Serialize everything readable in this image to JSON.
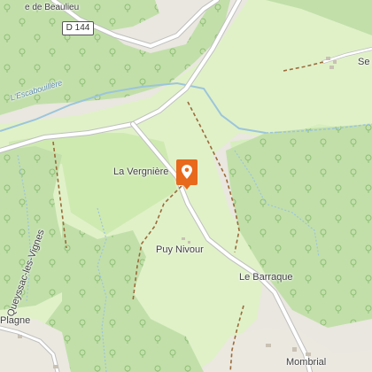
{
  "map": {
    "road_shield": "D 144",
    "labels": {
      "beaulieu": "e de Beaulieu",
      "escabouillere": "L'Escabouillère",
      "vergniere": "La Vergnière",
      "puy_nivour": "Puy Nivour",
      "barraque": "Le Barraque",
      "queyssac": "Queyssac-les-Vignes",
      "plagne": "Plagne",
      "mombrial": "Mombrial",
      "se": "Se"
    },
    "marker_icon": "map-pin-icon",
    "colors": {
      "forest": "#c2dfaa",
      "meadow": "#e0f1c8",
      "field": "#cfeab1",
      "water": "#9cc5db",
      "road": "#ffffff",
      "track": "#9b6b3a",
      "marker": "#e8681c"
    }
  }
}
